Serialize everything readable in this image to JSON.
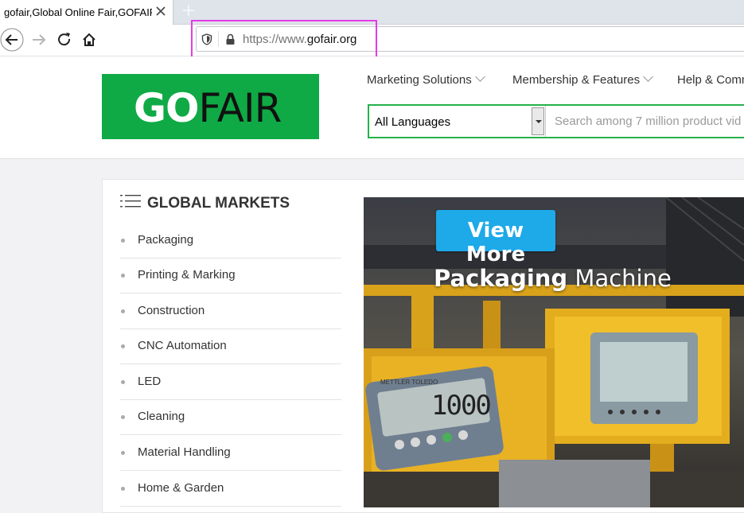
{
  "browser": {
    "tab_title": "gofair,Global Online Fair,GOFAIR",
    "url_prefix": "https://www.",
    "url_domain": "gofair.org",
    "url_suffix": ".org"
  },
  "header": {
    "logo_go": "GO",
    "logo_fair": "FAIR",
    "menu": [
      "Marketing Solutions",
      "Membership & Features",
      "Help & Comm"
    ],
    "language_select": "All Languages",
    "search_placeholder": "Search among 7 million product vid"
  },
  "sidebar": {
    "title": "GLOBAL MARKETS",
    "items": [
      "Packaging",
      "Printing & Marking",
      "Construction",
      "CNC Automation",
      "LED",
      "Cleaning",
      "Material Handling",
      "Home & Garden"
    ]
  },
  "banner": {
    "button_label": "View More",
    "caption_bold": "Packaging",
    "caption_rest": " Machine",
    "scale_brand": "METTLER TOLEDO",
    "scale_value": "1000"
  },
  "colors": {
    "brand_green": "#0faa45",
    "highlight": "#e33ce6",
    "button_blue": "#1ea9e8"
  }
}
